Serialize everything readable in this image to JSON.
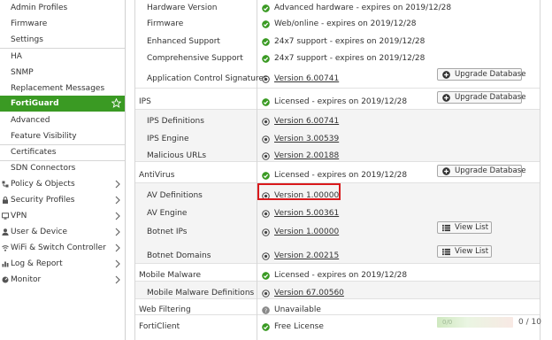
{
  "sidebar": {
    "items": [
      {
        "label": "Admin Profiles"
      },
      {
        "label": "Firmware"
      },
      {
        "label": "Settings"
      },
      {
        "label": "HA"
      },
      {
        "label": "SNMP"
      },
      {
        "label": "Replacement Messages"
      },
      {
        "label": "FortiGuard",
        "active": true
      },
      {
        "label": "Advanced"
      },
      {
        "label": "Feature Visibility"
      },
      {
        "label": "Certificates"
      },
      {
        "label": "SDN Connectors"
      }
    ],
    "groups": [
      {
        "label": "Policy & Objects",
        "icon": "policy-icon"
      },
      {
        "label": "Security Profiles",
        "icon": "lock-icon"
      },
      {
        "label": "VPN",
        "icon": "monitor-icon"
      },
      {
        "label": "User & Device",
        "icon": "user-icon"
      },
      {
        "label": "WiFi & Switch Controller",
        "icon": "wifi-icon"
      },
      {
        "label": "Log & Report",
        "icon": "chart-icon"
      },
      {
        "label": "Monitor",
        "icon": "gauge-icon"
      }
    ]
  },
  "table": {
    "rows": [
      {
        "name": "Hardware Version",
        "status": "Advanced hardware - expires on 2019/12/28"
      },
      {
        "name": "Firmware",
        "status": "Web/online - expires on 2019/12/28"
      },
      {
        "name": "Enhanced Support",
        "status": "24x7 support - expires on 2019/12/28"
      },
      {
        "name": "Comprehensive Support",
        "status": "24x7 support - expires on 2019/12/28"
      },
      {
        "name": "Application Control Signatures",
        "status": "Version 6.00741",
        "action": "Upgrade Database"
      },
      {
        "name": "IPS",
        "status": "Licensed - expires on 2019/12/28",
        "action": "Upgrade Database"
      },
      {
        "name": "IPS Definitions",
        "status": "Version 6.00741"
      },
      {
        "name": "IPS Engine",
        "status": "Version 3.00539"
      },
      {
        "name": "Malicious URLs",
        "status": "Version 2.00188"
      },
      {
        "name": "AntiVirus",
        "status": "Licensed - expires on 2019/12/28",
        "action": "Upgrade Database"
      },
      {
        "name": "AV Definitions",
        "status": "Version 1.00000"
      },
      {
        "name": "AV Engine",
        "status": "Version 5.00361"
      },
      {
        "name": "Botnet IPs",
        "status": "Version 1.00000",
        "action": "View List"
      },
      {
        "name": "Botnet Domains",
        "status": "Version 2.00215",
        "action": "View List"
      },
      {
        "name": "Mobile Malware",
        "status": "Licensed - expires on 2019/12/28"
      },
      {
        "name": "Mobile Malware Definitions",
        "status": "Version 67.00560"
      },
      {
        "name": "Web Filtering",
        "status": "Unavailable"
      },
      {
        "name": "FortiClient",
        "status": "Free License"
      }
    ],
    "forticlient_bar_text": "0/0",
    "forticlient_count": "0 / 10"
  },
  "colors": {
    "accent": "#3a9a23",
    "check": "#3a9a23",
    "highlight": "#d9191c"
  }
}
